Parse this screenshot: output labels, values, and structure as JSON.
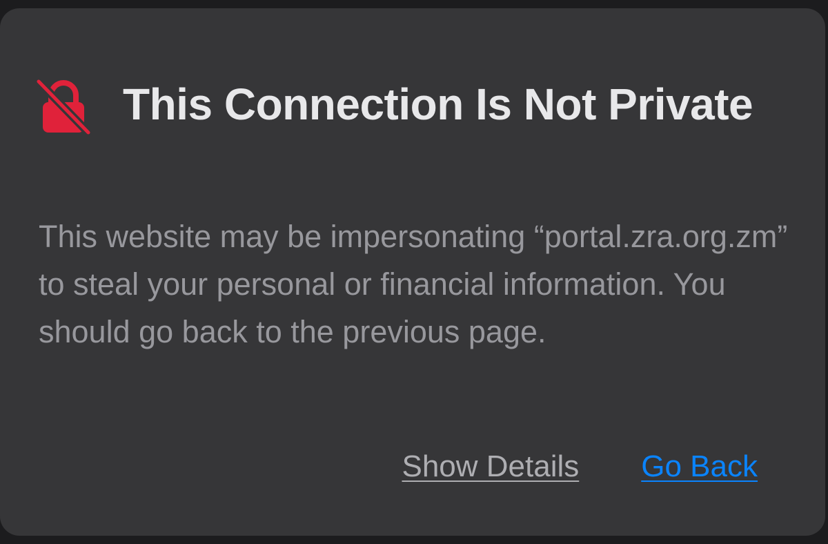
{
  "colors": {
    "background": "#1c1c1e",
    "card": "#363638",
    "title": "#e8e8ea",
    "body": "#98989d",
    "warning": "#e0223a",
    "link_primary": "#0a84ff",
    "link_secondary": "#aeaeb2"
  },
  "warning": {
    "icon": "lock-slash-icon",
    "title": "This Connection Is Not Private",
    "message": "This website may be impersonating “portal.zra.org.zm” to steal your personal or financial information. You should go back to the previous page."
  },
  "actions": {
    "show_details_label": "Show Details",
    "go_back_label": "Go Back"
  }
}
